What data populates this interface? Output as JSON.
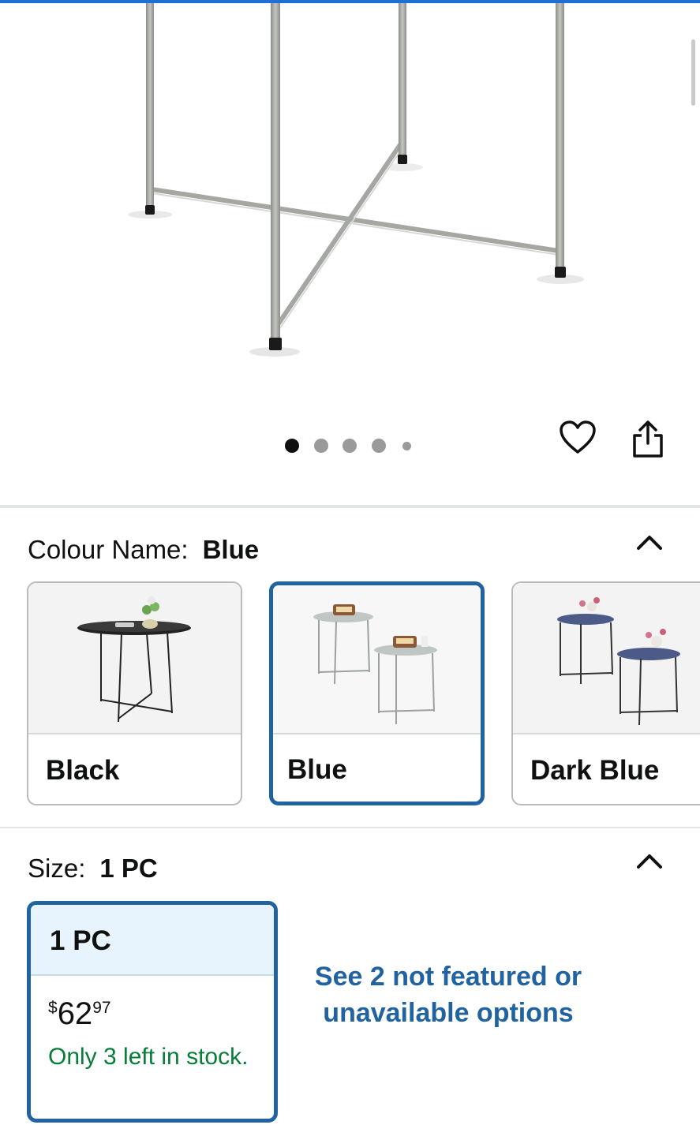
{
  "hero": {
    "image_alt": "grey metal folding table legs",
    "carousel": {
      "count": 5,
      "active_index": 0
    },
    "actions": {
      "wishlist_icon": "heart-icon",
      "share_icon": "share-icon"
    }
  },
  "colour": {
    "label": "Colour Name:",
    "selected_value": "Blue",
    "options": [
      {
        "name": "Black",
        "selected": false
      },
      {
        "name": "Blue",
        "selected": true
      },
      {
        "name": "Dark Blue",
        "selected": false
      }
    ]
  },
  "size": {
    "label": "Size:",
    "selected_value": "1 PC",
    "option": {
      "name": "1 PC",
      "price_currency": "$",
      "price_whole": "62",
      "price_fraction": "97",
      "stock_text": "Only 3 left in stock."
    },
    "see_more": "See 2 not featured or unavailable options"
  },
  "colors": {
    "accent": "#2162a1",
    "stock_green": "#067d39",
    "top_bar": "#1f6fd4"
  }
}
